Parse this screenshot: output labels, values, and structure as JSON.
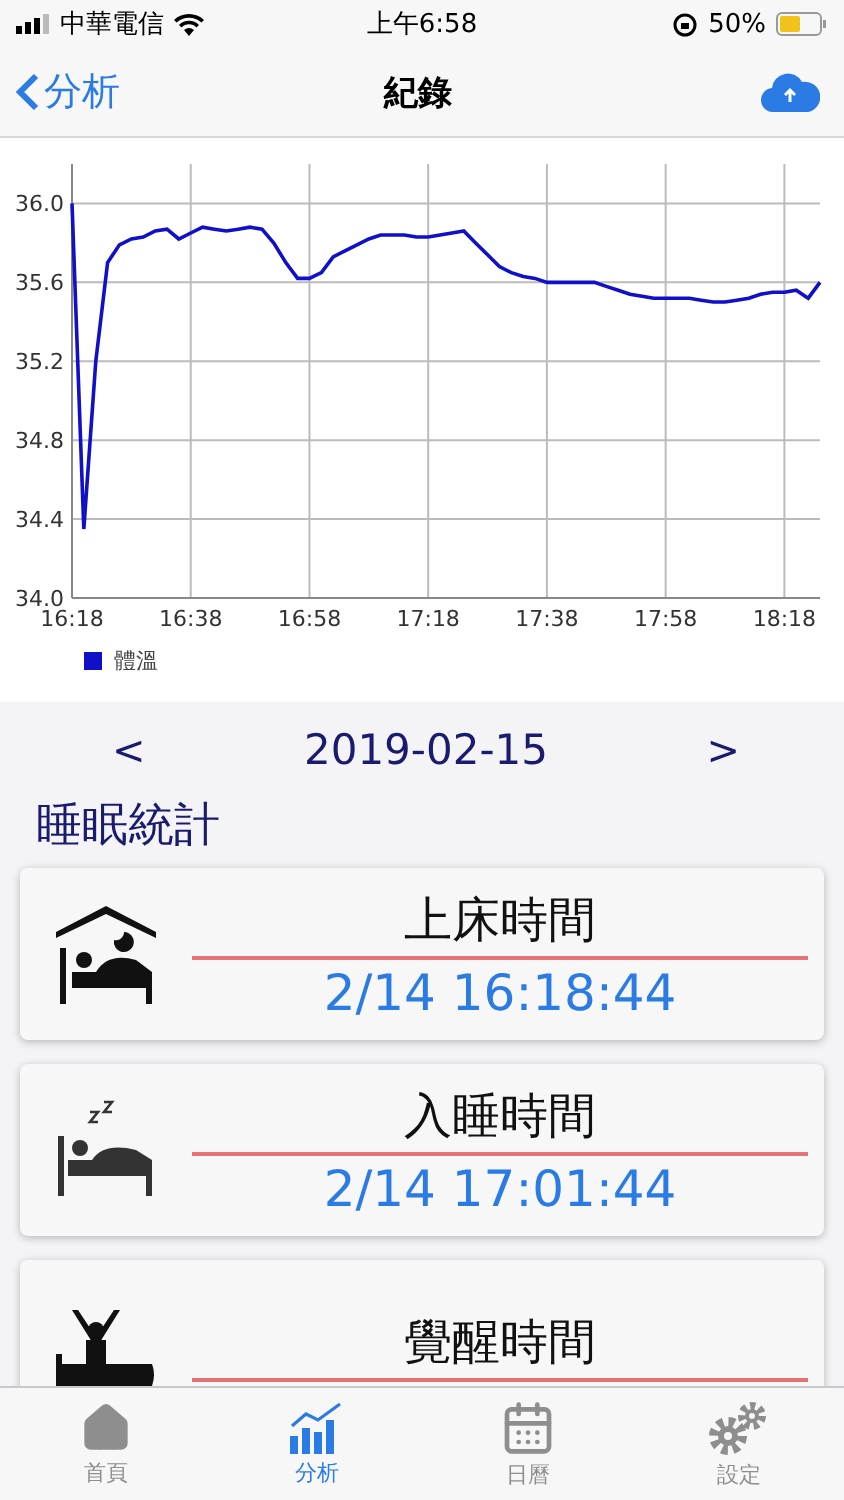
{
  "status_bar": {
    "carrier": "中華電信",
    "time": "上午6:58",
    "battery": "50%"
  },
  "nav": {
    "back": "分析",
    "title": "紀錄"
  },
  "chart": {
    "chart_data": {
      "type": "line",
      "categories": [
        "16:18",
        null,
        null,
        null,
        null,
        null,
        null,
        null,
        null,
        null,
        "16:38",
        null,
        null,
        null,
        null,
        null,
        null,
        null,
        null,
        null,
        "16:58",
        null,
        null,
        null,
        null,
        null,
        null,
        null,
        null,
        null,
        "17:18",
        null,
        null,
        null,
        null,
        null,
        null,
        null,
        null,
        null,
        "17:38",
        null,
        null,
        null,
        null,
        null,
        null,
        null,
        null,
        null,
        "17:58",
        null,
        null,
        null,
        null,
        null,
        null,
        null,
        null,
        null,
        "18:18",
        null,
        null,
        null
      ],
      "series": [
        {
          "name": "體溫",
          "color": "#1010c8",
          "values": [
            36.0,
            34.35,
            35.2,
            35.7,
            35.79,
            35.82,
            35.83,
            35.86,
            35.87,
            35.82,
            35.85,
            35.88,
            35.87,
            35.86,
            35.87,
            35.88,
            35.87,
            35.8,
            35.7,
            35.62,
            35.62,
            35.65,
            35.73,
            35.76,
            35.79,
            35.82,
            35.84,
            35.84,
            35.84,
            35.83,
            35.83,
            35.84,
            35.85,
            35.86,
            35.8,
            35.74,
            35.68,
            35.65,
            35.63,
            35.62,
            35.6,
            35.6,
            35.6,
            35.6,
            35.6,
            35.58,
            35.56,
            35.54,
            35.53,
            35.52,
            35.52,
            35.52,
            35.52,
            35.51,
            35.5,
            35.5,
            35.51,
            35.52,
            35.54,
            35.55,
            35.55,
            35.56,
            35.52,
            35.6
          ]
        }
      ],
      "grid": true,
      "ylim": [
        34.0,
        36.2
      ],
      "yticks": [
        {
          "value": 34.0,
          "label": "34.0"
        },
        {
          "value": 34.4,
          "label": "34.4"
        },
        {
          "value": 34.8,
          "label": "34.8"
        },
        {
          "value": 35.2,
          "label": "35.2"
        },
        {
          "value": 35.6,
          "label": "35.6"
        },
        {
          "value": 36.0,
          "label": "36.0"
        }
      ]
    }
  },
  "date_nav": {
    "prev": "<",
    "date": "2019-02-15",
    "next": ">"
  },
  "section_title": "睡眠統計",
  "cards": [
    {
      "kind": "bed",
      "title": "上床時間",
      "time": "2/14 16:18:44"
    },
    {
      "kind": "sleep",
      "title": "入睡時間",
      "time": "2/14 17:01:44"
    },
    {
      "kind": "wake",
      "title": "覺醒時間"
    }
  ],
  "tabs": [
    {
      "kind": "home",
      "label": "首頁",
      "selected": false
    },
    {
      "kind": "analysis",
      "label": "分析",
      "selected": true
    },
    {
      "kind": "calendar",
      "label": "日曆",
      "selected": false
    },
    {
      "kind": "settings",
      "label": "設定",
      "selected": false
    }
  ]
}
